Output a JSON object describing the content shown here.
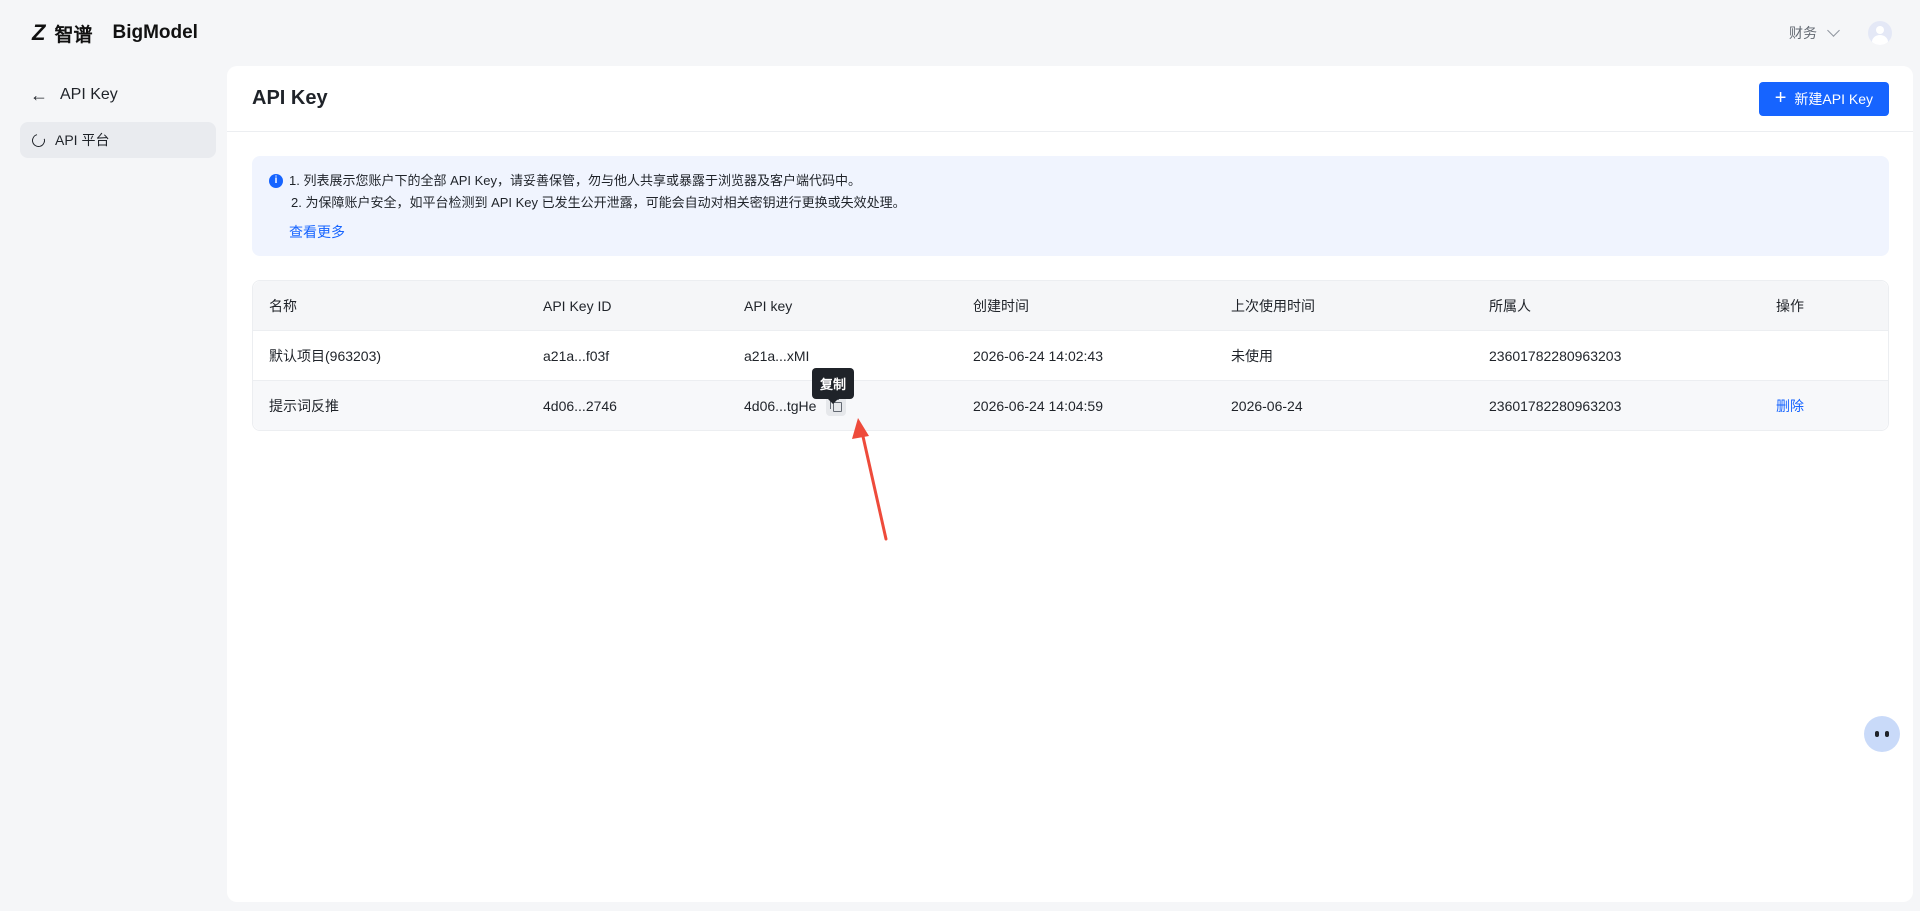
{
  "brand": {
    "mark": "Z",
    "name_zh": "智谱",
    "name_en": "BigModel"
  },
  "header": {
    "account_label": "财务"
  },
  "sidebar": {
    "back_label": "API Key",
    "items": [
      {
        "label": "API 平台"
      }
    ]
  },
  "main": {
    "title": "API Key",
    "new_button_label": "新建API Key",
    "new_button_icon": "plus-icon",
    "notice": {
      "line1": "1. 列表展示您账户下的全部 API Key，请妥善保管，勿与他人共享或暴露于浏览器及客户端代码中。",
      "line2": "2. 为保障账户安全，如平台检测到 API Key 已发生公开泄露，可能会自动对相关密钥进行更换或失效处理。",
      "link": "查看更多"
    },
    "table": {
      "columns": [
        "名称",
        "API Key ID",
        "API key",
        "创建时间",
        "上次使用时间",
        "所属人",
        "操作"
      ],
      "rows": [
        {
          "name": "默认项目(963203)",
          "key_id": "a21a...f03f",
          "api_key": "a21a...xMI",
          "created": "2026-06-24 14:02:43",
          "last_used": "未使用",
          "owner": "23601782280963203",
          "action": ""
        },
        {
          "name": "提示词反推",
          "key_id": "4d06...2746",
          "api_key": "4d06...tgHe",
          "created": "2026-06-24 14:04:59",
          "last_used": "2026-06-24",
          "owner": "23601782280963203",
          "action": "删除"
        }
      ]
    },
    "tooltip": "复制"
  },
  "colors": {
    "primary": "#1664ff",
    "annotation": "#ee4b3b",
    "notice_bg": "#f0f4fe"
  }
}
